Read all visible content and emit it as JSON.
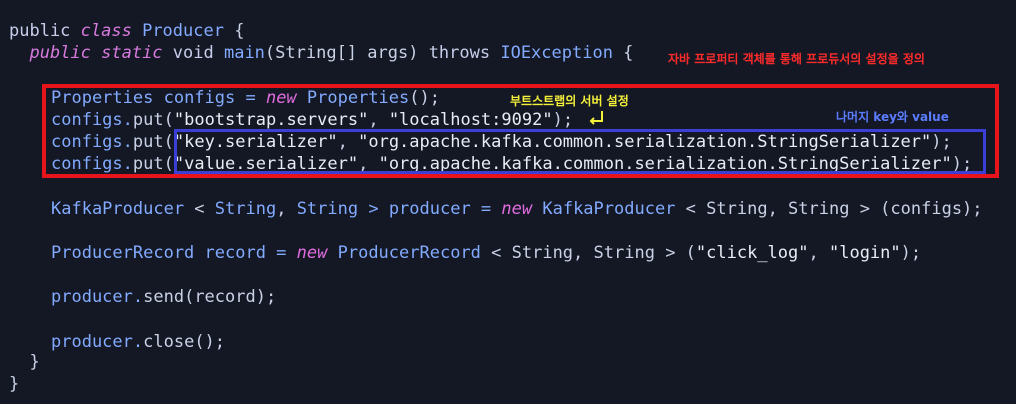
{
  "code_lines": [
    {
      "parts": [
        "public ",
        "class ",
        "Producer",
        " {"
      ]
    },
    {
      "parts": [
        "  public ",
        "static ",
        "void ",
        "main",
        "(String[] args) ",
        "throws ",
        "IOException",
        " {"
      ]
    },
    {
      "parts": [
        "Properties",
        " configs = ",
        "new ",
        "Properties",
        "();"
      ]
    },
    {
      "parts": [
        "configs.",
        "put",
        "(",
        "\"bootstrap.servers\"",
        ", ",
        "\"localhost:9092\"",
        ");"
      ]
    },
    {
      "parts": [
        "configs.",
        "put",
        "(",
        "\"key.serializer\"",
        ", ",
        "\"org.apache.kafka.common.serialization.StringSerializer\"",
        ");"
      ]
    },
    {
      "parts": [
        "configs.",
        "put",
        "(",
        "\"value.serializer\"",
        ", ",
        "\"org.apache.kafka.common.serialization.StringSerializer\"",
        ");"
      ]
    },
    {
      "parts": [
        "KafkaProducer",
        " < ",
        "String",
        ", ",
        "String",
        " > producer = ",
        "new ",
        "KafkaProducer",
        " < ",
        "String",
        ", ",
        "String",
        " > (configs);"
      ]
    },
    {
      "parts": [
        "ProducerRecord",
        " record = ",
        "new ",
        "ProducerRecord",
        " < ",
        "String",
        ", ",
        "String",
        " > (",
        "\"click_log\"",
        ", ",
        "\"login\"",
        ");"
      ]
    },
    {
      "parts": [
        "producer.",
        "send",
        "(record);"
      ]
    },
    {
      "parts": [
        "producer.",
        "close",
        "();"
      ]
    },
    {
      "parts": [
        "  }"
      ]
    },
    {
      "parts": [
        "}"
      ]
    }
  ],
  "annotations": {
    "red": "자바 프로퍼티 객체를 통해 프로듀서의 설정을 정의",
    "yellow": "부트스트랩의 서버 설정",
    "blue": "나머지 key와 value"
  },
  "colors": {
    "red_box": "#e8141b",
    "blue_box": "#3b3fd6",
    "background": "#141824"
  }
}
